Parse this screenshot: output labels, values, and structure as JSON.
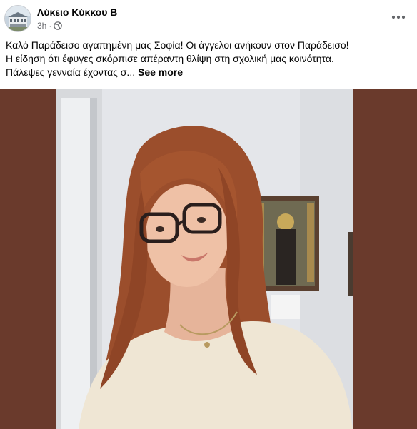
{
  "post": {
    "author": "Λύκειο Κύκκου Β",
    "timestamp": "3h",
    "separator": "·",
    "privacy_icon": "globe-icon",
    "more_icon": "more-horizontal-icon",
    "caption_lines": [
      "Καλό Παράδεισο αγαπημένη μας Σοφία! Οι άγγελοι ανήκουν στον Παράδεισο!",
      "Η είδηση ότι έφυγες σκόρπισε απέραντη θλίψη στη σχολική μας κοινότητα.",
      "Πάλεψες γενναία έχοντας σ..."
    ],
    "see_more_label": "See more"
  },
  "photo": {
    "description_icon": "post-photo",
    "frame_color": "#6a3a2c"
  }
}
